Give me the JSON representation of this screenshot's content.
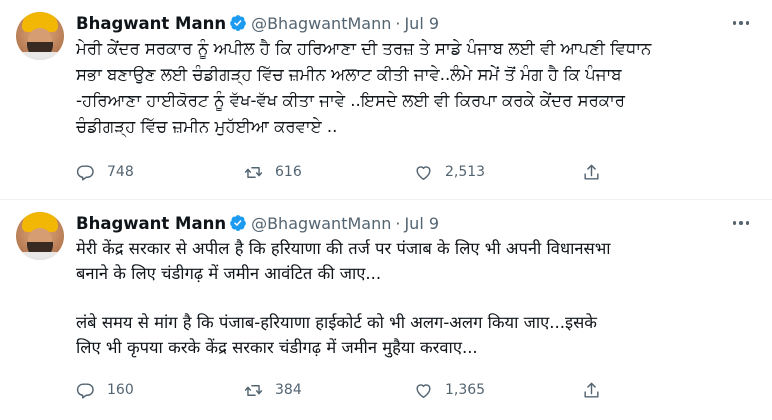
{
  "tweets": [
    {
      "author_name": "Bhagwant Mann",
      "handle": "@BhagwantMann",
      "separator": "·",
      "date": "Jul 9",
      "text": "ਮੇਰੀ ਕੇਂਦਰ ਸਰਕਾਰ ਨੂੰ ਅਪੀਲ ਹੈ ਕਿ ਹਰਿਆਣਾ ਦੀ ਤਰਜ਼ ਤੇ ਸਾਡੇ ਪੰਜਾਬ ਲਈ ਵੀ ਆਪਣੀ ਵਿਧਾਨ\nਸਭਾ ਬਣਾਉਣ ਲਈ ਚੰਡੀਗੜ੍ਹ ਵਿੱਚ ਜ਼ਮੀਨ ਅਲਾਟ ਕੀਤੀ ਜਾਵੇ..ਲੰਮੇ ਸਮੇਂ ਤੋਂ ਮੰਗ ਹੈ ਕਿ ਪੰਜਾਬ\n-ਹਰਿਆਣਾ ਹਾਈਕੋਰਟ ਨੂੰ ਵੱਖ-ਵੱਖ ਕੀਤਾ ਜਾਵੇ ..ਇਸਦੇ ਲਈ ਵੀ ਕਿਰਪਾ ਕਰਕੇ ਕੇਂਦਰ ਸਰਕਾਰ\nਚੰਡੀਗੜ੍ਹ ਵਿੱਚ ਜ਼ਮੀਨ ਮੁਹੱਈਆ ਕਰਵਾਏ ..",
      "replies": "748",
      "retweets": "616",
      "likes": "2,513"
    },
    {
      "author_name": "Bhagwant Mann",
      "handle": "@BhagwantMann",
      "separator": "·",
      "date": "Jul 9",
      "text": "मेरी केंद्र सरकार से अपील है कि हरियाणा की तर्ज पर पंजाब के लिए भी अपनी विधानसभा\nबनाने के लिए चंडीगढ़ में जमीन आवंटित की जाए...",
      "text2": "लंबे समय से मांग है कि पंजाब-हरियाणा हाईकोर्ट को भी अलग-अलग किया जाए...इसके\nलिए भी कृपया करके केंद्र सरकार चंडीगढ़ में जमीन मुहैया करवाए...",
      "replies": "160",
      "retweets": "384",
      "likes": "1,365"
    }
  ],
  "icons": {
    "verified": "verified-badge-icon",
    "more": "more-options-icon",
    "reply": "reply-icon",
    "retweet": "retweet-icon",
    "like": "heart-icon",
    "share": "share-icon"
  },
  "colors": {
    "verified_blue": "#1d9bf0",
    "muted": "#536471",
    "text": "#0f1419",
    "divider": "#eff3f4"
  }
}
